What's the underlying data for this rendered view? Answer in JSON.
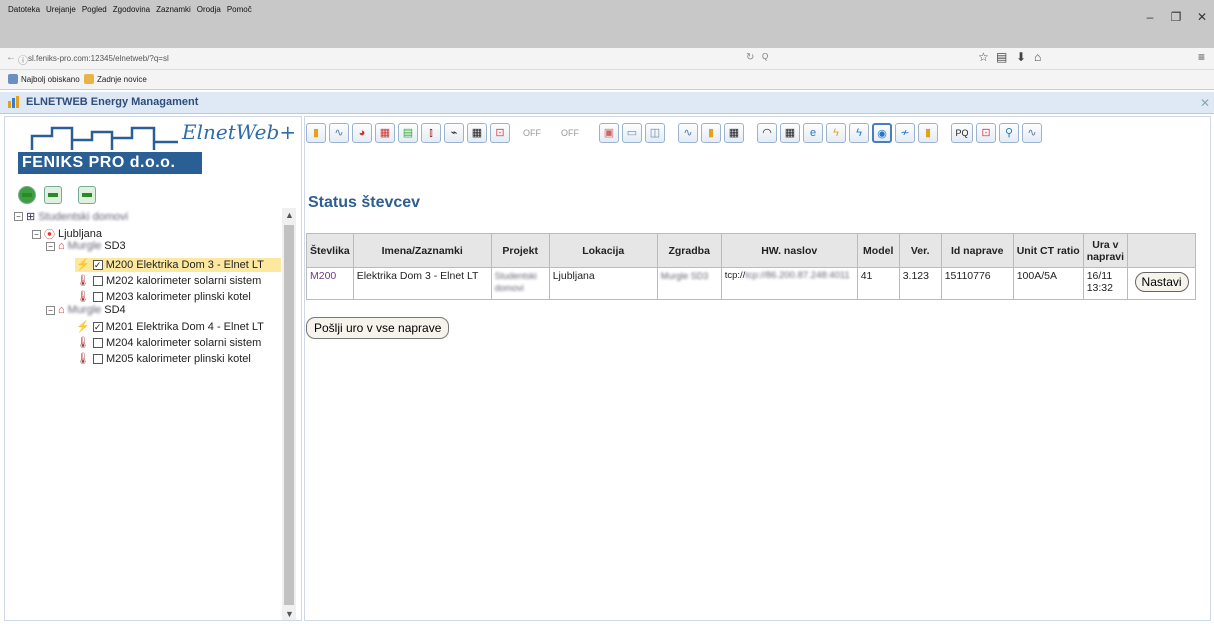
{
  "browser": {
    "menu": [
      "Datoteka",
      "Urejanje",
      "Pogled",
      "Zgodovina",
      "Zaznamki",
      "Orodja",
      "Pomoč"
    ],
    "url": "sl.feniks-pro.com:12345/elnetweb/?q=sl",
    "search_placeholder": "Q",
    "bookmarks": [
      "Najbolj obiskano",
      "Zadnje novice"
    ]
  },
  "app": {
    "title": "ELNETWEB Energy Managament",
    "brand_script": "ElnetWeb+",
    "brand_name": "FENIKS PRO d.o.o."
  },
  "tree": {
    "root": "Studentski domovi",
    "city": "Ljubljana",
    "buildings": [
      {
        "name_blurred": "Murgle",
        "code": "SD3",
        "devices": [
          {
            "label": "M200 Elektrika Dom 3 - Elnet LT",
            "checked": true,
            "icon": "bolt-icon"
          },
          {
            "label": "M202 kalorimeter solarni sistem",
            "checked": false,
            "icon": "thermometer-icon"
          },
          {
            "label": "M203 kalorimeter plinski kotel",
            "checked": false,
            "icon": "thermometer-icon"
          }
        ]
      },
      {
        "name_blurred": "Murgle",
        "code": "SD4",
        "devices": [
          {
            "label": "M201 Elektrika Dom 4 - Elnet LT",
            "checked": true,
            "icon": "bolt-icon"
          },
          {
            "label": "M204 kalorimeter solarni sistem",
            "checked": false,
            "icon": "thermometer-icon"
          },
          {
            "label": "M205 kalorimeter plinski kotel",
            "checked": false,
            "icon": "thermometer-icon"
          }
        ]
      }
    ]
  },
  "toolbar": {
    "off1": "OFF",
    "off2": "OFF",
    "pq": "PQ"
  },
  "main": {
    "heading": "Status števcev",
    "columns": [
      "Števlika",
      "Imena/Zaznamki",
      "Projekt",
      "Lokacija",
      "Zgradba",
      "HW. naslov",
      "Model",
      "Ver.",
      "Id naprave",
      "Unit CT ratio",
      "Ura v napravi",
      ""
    ],
    "row": {
      "stevilka": "M200",
      "ime": "Elektrika Dom 3 - Elnet LT",
      "projekt": "Studentski domovi",
      "lokacija": "Ljubljana",
      "zgradba": "Murgle SD3",
      "hw": "tcp://86.200.87.248:4011",
      "hw_prefix": "tcp://",
      "model": "41",
      "ver": "3.123",
      "id": "15110776",
      "ct": "100A/5A",
      "ura": "16/11 13:32",
      "action": "Nastavi"
    },
    "send_button": "Pošlji uro v vse naprave"
  },
  "colors": {
    "accent": "#2e5e93",
    "brand_box": "#2a5f96",
    "selected_row": "#fde8a0"
  }
}
